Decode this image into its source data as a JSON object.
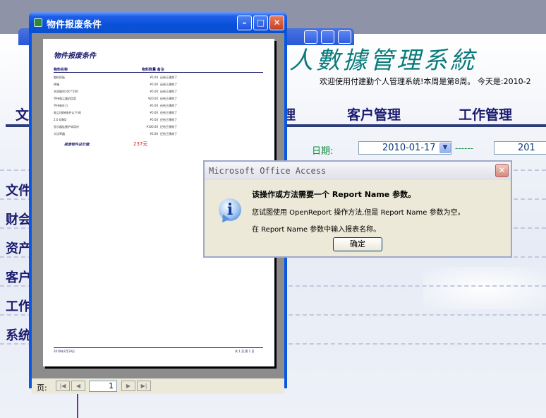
{
  "app": {
    "title_visible": "人數據管理系統",
    "welcome": "欢迎使用付建勤个人管理系统!本周是第8周。 今天是:2010-2",
    "nav": [
      "文",
      "理",
      "客户管理",
      "工作管理"
    ],
    "date_label": "日期:",
    "date_from": "2010-01-17",
    "date_sep": "------",
    "date_to": "201",
    "sidebar": [
      "文件",
      "财会",
      "资产",
      "客户",
      "工作",
      "系统"
    ]
  },
  "report_window": {
    "title": "物件报废条件",
    "report": {
      "title": "物件报废条件",
      "col_name": "物料名称",
      "col_qty": "物料数量 备注",
      "rows": [
        {
          "name": "塑料扣板",
          "qty": "¥5.00",
          "remark": "还给王建南了"
        },
        {
          "name": "砖箱",
          "qty": "¥5.00",
          "remark": "还给王建南了"
        },
        {
          "name": "木质窗帘100 *100",
          "qty": "¥5.00",
          "remark": "还给王建南了"
        },
        {
          "name": "手持吸尘器机用类",
          "qty": "¥20.00",
          "remark": "还给王建南了"
        },
        {
          "name": "手持吸叶刀",
          "qty": "¥5.00",
          "remark": "还给王建南了"
        },
        {
          "name": "吸尘(改装吸件以下)的",
          "qty": "¥5.00",
          "remark": "还给王建南了"
        },
        {
          "name": "2.0 印刷2",
          "qty": "¥5.00",
          "remark": "还给王建南了"
        },
        {
          "name": "显示器连接护如用帘",
          "qty": "¥100.00",
          "remark": "还给王建南了"
        },
        {
          "name": "大功率器",
          "qty": "¥2.00",
          "remark": "还给王建南了"
        }
      ],
      "total_label": "报废物件总价值:",
      "total_value": "237元",
      "footer_left": "2010年2月19日",
      "footer_right": "共 1 页,第 1 页"
    },
    "pager_label": "页:",
    "page_number": "1"
  },
  "message_box": {
    "title": "Microsoft Office Access",
    "line1": "该操作或方法需要一个 Report Name 参数。",
    "line2": "您试图使用 OpenReport 操作方法,但是 Report Name 参数为空。",
    "line3": "在 Report Name 参数中输入报表名称。",
    "ok_label": "确定"
  }
}
